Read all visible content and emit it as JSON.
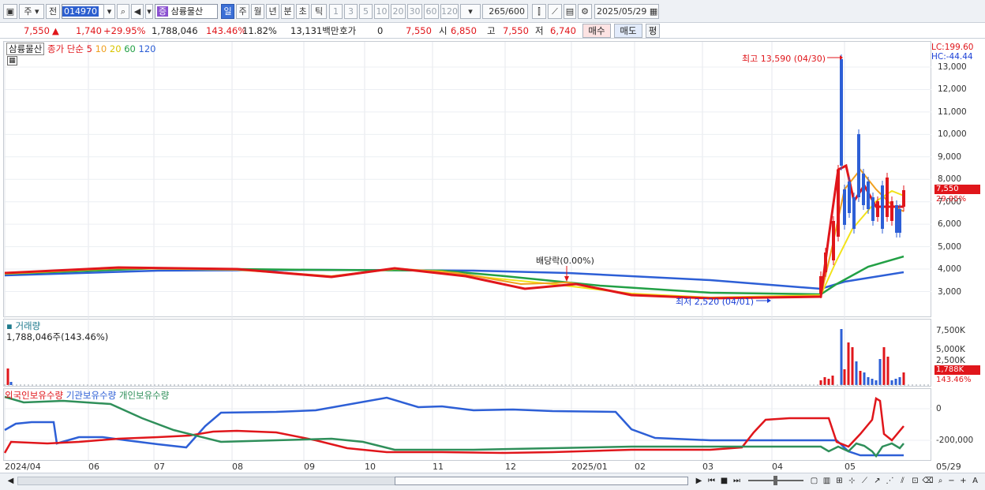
{
  "toolbar": {
    "period_select": "주",
    "prev_label": "전",
    "code": "014970",
    "stock_name": "삼륭물산",
    "intervals": [
      "일",
      "주",
      "월",
      "년",
      "분",
      "초",
      "틱"
    ],
    "selected_interval": "일",
    "units": [
      "1",
      "3",
      "5",
      "10",
      "20",
      "30",
      "60",
      "120"
    ],
    "count": "265",
    "count_max": "/600",
    "date": "2025/05/29"
  },
  "quote": {
    "price": "7,550",
    "change": "1,740",
    "change_pct": "+29.95%",
    "volume": "1,788,046",
    "volume_ratio": "143.46%",
    "turnover": "11.82%",
    "amount": "13,131백만",
    "hoga_label": "호가",
    "hoga_value": "0",
    "hoga_price": "7,550",
    "open_label": "시",
    "open": "6,850",
    "high_label": "고",
    "high": "7,550",
    "low_label": "저",
    "low": "6,740",
    "buy_label": "매수",
    "sell_label": "매도",
    "avg_label": "평"
  },
  "price_panel": {
    "legend_name": "삼륭물산",
    "legend_ma": "종가 단순",
    "ma_periods": [
      "5",
      "10",
      "20",
      "60",
      "120"
    ],
    "ma_colors": [
      "#e0161b",
      "#f0a020",
      "#f2e21a",
      "#22a045",
      "#2d5fd6"
    ],
    "lc": "LC:199.60",
    "hc": "HC:-44.44",
    "high_marker": "최고 13,590 (04/30)",
    "low_marker": "최저 2,520 (04/01)",
    "dividend_marker": "배당락(0.00%)",
    "price_tag": "7,550",
    "pct_tag": "29.95%",
    "y_ticks": [
      "13,000",
      "12,000",
      "11,000",
      "10,000",
      "9,000",
      "8,000",
      "7,000",
      "6,000",
      "5,000",
      "4,000",
      "3,000"
    ]
  },
  "volume_panel": {
    "title": "거래량",
    "value": "1,788,046주(143.46%)",
    "y_ticks": [
      "7,500K",
      "5,000K",
      "2,500K"
    ],
    "tag": "1,788K",
    "pct_tag": "143.46%"
  },
  "holder_panel": {
    "legend": [
      "외국인보유수량",
      "기관보유수량",
      "개인보유수량"
    ],
    "colors": [
      "#e0161b",
      "#2d5fd6",
      "#2f8f5a"
    ],
    "y_ticks": [
      "0",
      "-200,000"
    ]
  },
  "x_axis": [
    "2024/04",
    "06",
    "07",
    "08",
    "09",
    "10",
    "11",
    "12",
    "2025/01",
    "02",
    "03",
    "04",
    "05",
    "05/29"
  ]
}
